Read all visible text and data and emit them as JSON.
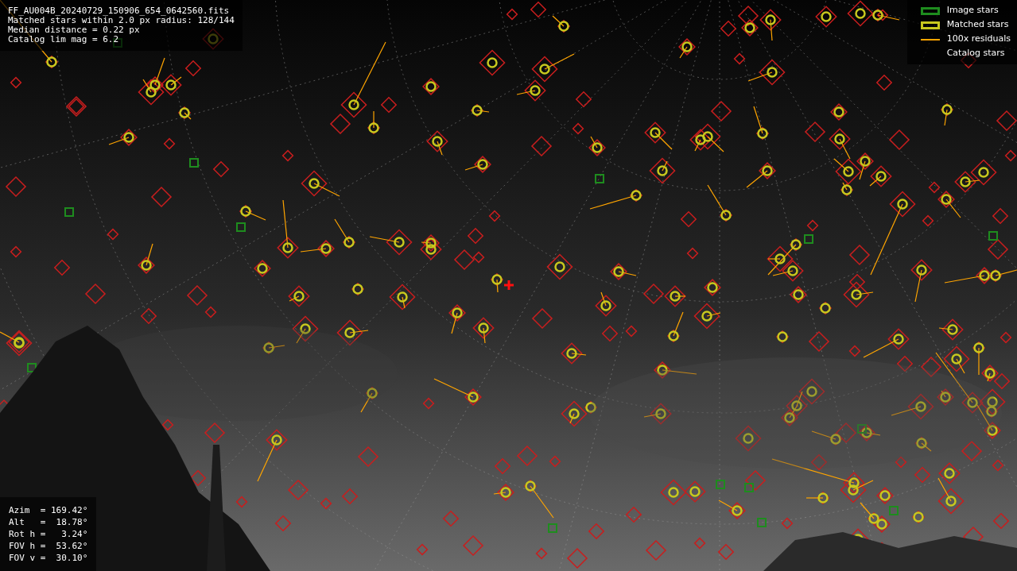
{
  "info": [
    "FF_AU004B_20240729_150906_654_0642560.fits",
    "Matched stars within 2.0 px radius: 128/144",
    "Median distance = 0.22 px",
    "Catalog lim mag = 6.2"
  ],
  "legend": [
    {
      "label": "Image stars"
    },
    {
      "kind": "matched",
      "label": "Matched stars"
    },
    {
      "kind": "residual",
      "label": "100x residuals"
    },
    {
      "kind": "catalog",
      "label": "Catalog stars"
    }
  ],
  "pointing": [
    "Azim  = 169.42°",
    "Alt   =  18.78°",
    "Rot h =   3.24°",
    "FOV h =  53.62°",
    "FOV v =  30.10°"
  ]
}
